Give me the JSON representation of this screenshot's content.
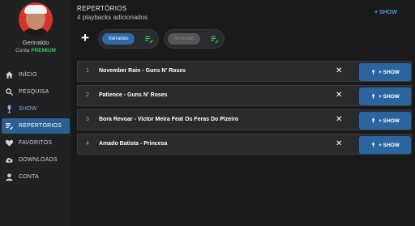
{
  "user": {
    "name": "Gerinaldo",
    "account_prefix": "Conta",
    "account_tier": "PREMIUM"
  },
  "nav": [
    {
      "label": "INÍCIO",
      "icon": "home-icon"
    },
    {
      "label": "PESQUISA",
      "icon": "search-icon"
    },
    {
      "label": "SHOW",
      "icon": "microphone-icon"
    },
    {
      "label": "REPERTÓRIOS",
      "icon": "playlist-icon"
    },
    {
      "label": "FAVORITOS",
      "icon": "heart-icon"
    },
    {
      "label": "DOWNLOADS",
      "icon": "cloud-download-icon"
    },
    {
      "label": "CONTA",
      "icon": "person-icon"
    }
  ],
  "header": {
    "title": "REPERTÓRIOS",
    "subtitle": "4 playbacks adicionados",
    "show_label": "+ SHOW",
    "add_label": "+"
  },
  "repertoires": [
    {
      "label": "Variadas",
      "selected": true
    },
    {
      "label": "Amacaio",
      "selected": false
    }
  ],
  "songs": [
    {
      "num": "1",
      "title": "November Rain - Guns N' Roses",
      "remove": "✕",
      "show_label": "+ SHOW"
    },
    {
      "num": "2",
      "title": "Patience - Guns N' Roses",
      "remove": "✕",
      "show_label": "+ SHOW"
    },
    {
      "num": "3",
      "title": "Bora Revoar - Victor Meira Feat Os Feras Do Pizeiro",
      "remove": "✕",
      "show_label": "+ SHOW"
    },
    {
      "num": "4",
      "title": "Amado Batista - Princesa",
      "remove": "✕",
      "show_label": "+ SHOW"
    }
  ],
  "colors": {
    "accent": "#2c6aa8",
    "premium": "#35c759",
    "background": "#191a1c",
    "sidebar": "#202123"
  }
}
